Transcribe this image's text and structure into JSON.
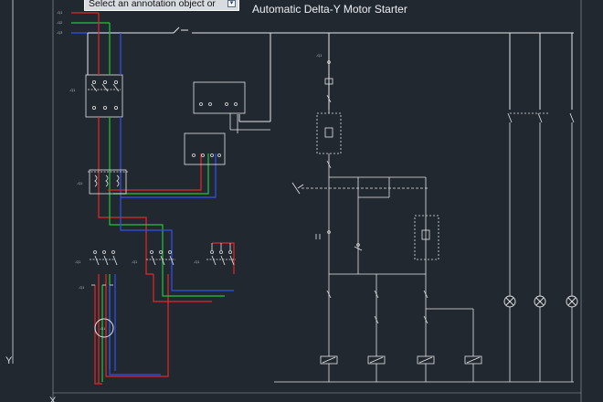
{
  "drawing": {
    "title": "Automatic Delta-Y Motor Starter",
    "phase_labels": [
      "-Q1",
      "-Q2",
      "-Q3"
    ],
    "device_labels": {
      "main_switch": "-Q1",
      "overload": "-Q1",
      "star_contactor": "-Q1",
      "delta_contactor": "-Q1",
      "line_contactor": "-Q1",
      "motor": "-Q1",
      "control_fuse": "-Q1"
    },
    "colors": {
      "background": "#212830",
      "wire_white": "#e8e8e8",
      "phase_red": "#e02828",
      "phase_green": "#22c43a",
      "phase_blue": "#3050f0",
      "title_text": "#eef0f2"
    }
  },
  "annotation": {
    "prompt": "Select an annotation object or",
    "button_icon": "dropdown-arrow-icon"
  },
  "ucs": {
    "x_label": "X",
    "y_label": "Y"
  }
}
